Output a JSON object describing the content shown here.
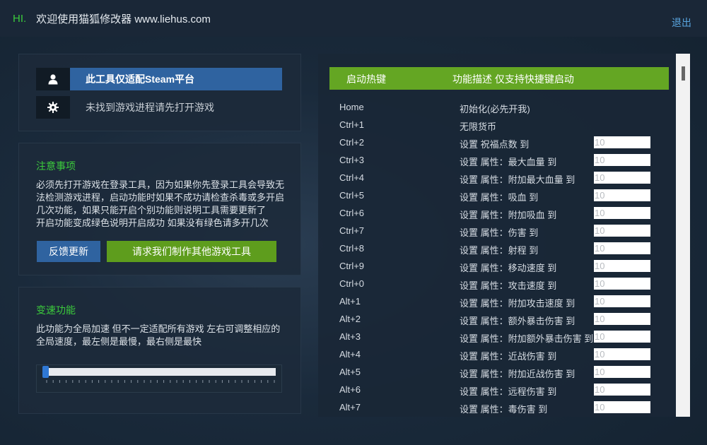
{
  "titlebar": {
    "hi": "HI.",
    "welcome": "欢迎使用猫狐修改器 www.liehus.com",
    "logout": "退出"
  },
  "platform": {
    "steam_label": "此工具仅适配Steam平台",
    "process_status": "未找到游戏进程请先打开游戏",
    "user_icon": "user-icon",
    "gear_icon": "gear-icon"
  },
  "notice": {
    "title": "注意事项",
    "lines": [
      "必须先打开游戏在登录工具，因为如果你先登录工具会导致无",
      "法检测游戏进程，启动功能时如果不成功请检查杀毒或多开启",
      "几次功能，如果只能开启个别功能则说明工具需要更新了",
      "开启功能变成绿色说明开启成功 如果没有绿色请多开几次"
    ],
    "feedback_button": "反馈更新",
    "request_button": "请求我们制作其他游戏工具"
  },
  "speed": {
    "title": "变速功能",
    "lines": [
      "此功能为全局加速 但不一定适配所有游戏 左右可调整相应的",
      "全局速度，最左侧是最慢，最右侧是最快"
    ],
    "slider_value": 0
  },
  "hotkeys": {
    "header_key": "启动热键",
    "header_desc": "功能描述 仅支持快捷键启动",
    "rows": [
      {
        "key": "Home",
        "desc": "初始化(必先开我)",
        "value": null
      },
      {
        "key": "Ctrl+1",
        "desc": "无限货币",
        "value": null
      },
      {
        "key": "Ctrl+2",
        "desc": "设置 祝福点数 到",
        "value": "10"
      },
      {
        "key": "Ctrl+3",
        "desc": "设置 属性：最大血量 到",
        "value": "10"
      },
      {
        "key": "Ctrl+4",
        "desc": "设置 属性：附加最大血量 到",
        "value": "10"
      },
      {
        "key": "Ctrl+5",
        "desc": "设置 属性：吸血 到",
        "value": "10"
      },
      {
        "key": "Ctrl+6",
        "desc": "设置 属性：附加吸血 到",
        "value": "10"
      },
      {
        "key": "Ctrl+7",
        "desc": "设置 属性：伤害 到",
        "value": "10"
      },
      {
        "key": "Ctrl+8",
        "desc": "设置 属性：射程 到",
        "value": "10"
      },
      {
        "key": "Ctrl+9",
        "desc": "设置 属性：移动速度 到",
        "value": "10"
      },
      {
        "key": "Ctrl+0",
        "desc": "设置 属性：攻击速度 到",
        "value": "10"
      },
      {
        "key": "Alt+1",
        "desc": "设置 属性：附加攻击速度 到",
        "value": "10"
      },
      {
        "key": "Alt+2",
        "desc": "设置 属性：额外暴击伤害 到",
        "value": "10"
      },
      {
        "key": "Alt+3",
        "desc": "设置 属性：附加额外暴击伤害 到",
        "value": "10"
      },
      {
        "key": "Alt+4",
        "desc": "设置 属性：近战伤害 到",
        "value": "10"
      },
      {
        "key": "Alt+5",
        "desc": "设置 属性：附加近战伤害 到",
        "value": "10"
      },
      {
        "key": "Alt+6",
        "desc": "设置 属性：远程伤害 到",
        "value": "10"
      },
      {
        "key": "Alt+7",
        "desc": "设置 属性：毒伤害 到",
        "value": "10"
      }
    ]
  },
  "colors": {
    "accent_green": "#64a623",
    "accent_blue": "#2f63a0",
    "title_green": "#3ccb3c",
    "link_blue": "#5aa6e0"
  }
}
